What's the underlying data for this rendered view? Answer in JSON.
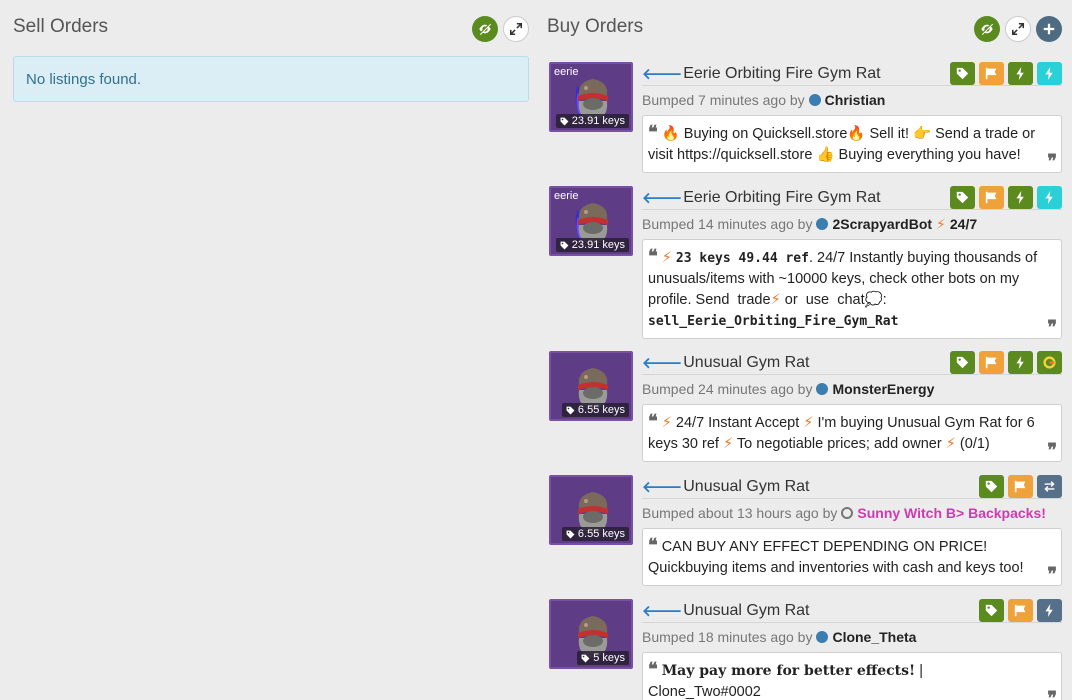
{
  "sell": {
    "title": "Sell Orders",
    "empty_text": "No listings found."
  },
  "buy": {
    "title": "Buy Orders",
    "listings": [
      {
        "name": "Eerie Orbiting Fire Gym Rat",
        "thumb_tag": "eerie",
        "price": "23.91 keys",
        "bumped": "Bumped 7 minutes ago by",
        "user": "Christian",
        "quote_parts": [
          "Buying on Quicksell.store",
          "Sell it!",
          "Send a trade or visit https://quicksell.store",
          "Buying everything you have!"
        ]
      },
      {
        "name": "Eerie Orbiting Fire Gym Rat",
        "thumb_tag": "eerie",
        "price": "23.91 keys",
        "bumped": "Bumped 14 minutes ago by",
        "user": "2ScrapyardBot",
        "user_suffix": "24/7",
        "quote_bold": "23 keys 49.44 ref",
        "quote_text": ". 24/7 Instantly buying thousands of unusuals/items with ~10000 keys, check other bots on my profile. Send",
        "quote_trade": "trade",
        "quote_or": "or",
        "quote_use": "use",
        "quote_chat": "chat",
        "quote_cmd": "sell_Eerie_Orbiting_Fire_Gym_Rat"
      },
      {
        "name": "Unusual Gym Rat",
        "price": "6.55 keys",
        "bumped": "Bumped 24 minutes ago by",
        "user": "MonsterEnergy",
        "quote_parts": [
          "24/7 Instant Accept",
          "I'm buying Unusual Gym Rat for 6 keys 30 ref",
          "To negotiable prices; add owner",
          "(0/1)"
        ]
      },
      {
        "name": "Unusual Gym Rat",
        "price": "6.55 keys",
        "bumped": "Bumped about 13 hours ago by",
        "user": "Sunny Witch B> Backpacks!",
        "quote": "CAN BUY ANY EFFECT DEPENDING ON PRICE! Quickbuying items and inventories with cash and keys too!"
      },
      {
        "name": "Unusual Gym Rat",
        "price": "5 keys",
        "bumped": "Bumped 18 minutes ago by",
        "user": "Clone_Theta",
        "quote_bold": "May pay more for better effects!",
        "quote_rest": " | Clone_Two#0002"
      }
    ]
  },
  "colors": {
    "green": "#5b8a1e",
    "orange": "#f0a23a",
    "cyan": "#29d0d8",
    "slate": "#56708a",
    "thumb_bg": "#5e3c86",
    "alert_bg": "#dbeef5"
  },
  "icons": {
    "hide": "eye-slash-icon",
    "expand": "expand-icon",
    "add": "plus-icon",
    "tag": "tag-icon",
    "flag": "flag-icon",
    "bolt": "bolt-icon",
    "exchange": "exchange-icon",
    "gamebanana": "g-logo-icon"
  }
}
